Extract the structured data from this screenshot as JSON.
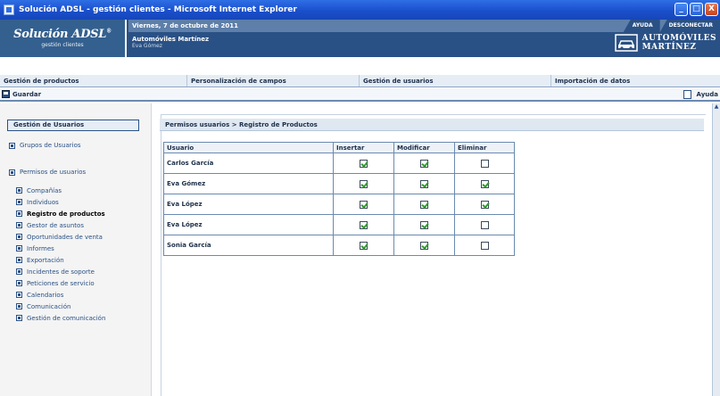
{
  "window": {
    "title": "Solución ADSL - gestión clientes - Microsoft Internet Explorer",
    "buttons": [
      "_",
      "□",
      "X"
    ]
  },
  "header": {
    "logo_title": "Solución ADSL",
    "logo_tm": "®",
    "logo_subtitle": "gestión clientes",
    "date": "Viernes, 7 de octubre de 2011",
    "links": [
      "AYUDA",
      "DESCONECTAR"
    ],
    "company": "Automóviles Martínez",
    "user": "Eva Gómez",
    "brand_line1": "AUTOMÓVILES",
    "brand_line2": "MARTÍNEZ",
    "brand_icon": "car-icon"
  },
  "nav": {
    "items": [
      "Gestión de productos",
      "Personalización de campos",
      "Gestión de usuarios",
      "Importación de datos"
    ]
  },
  "toolbar": {
    "save_label": "Guardar",
    "save_icon": "save-icon",
    "help_label": "Ayuda",
    "help_icon": "help-icon"
  },
  "sidebar": {
    "title": "Gestión de Usuarios",
    "groups_label": "Grupos de Usuarios",
    "permissions_label": "Permisos de usuarios",
    "items": [
      {
        "label": "Compañías",
        "active": false
      },
      {
        "label": "Individuos",
        "active": false
      },
      {
        "label": "Registro de productos",
        "active": true
      },
      {
        "label": "Gestor de asuntos",
        "active": false
      },
      {
        "label": "Oportunidades de venta",
        "active": false
      },
      {
        "label": "Informes",
        "active": false
      },
      {
        "label": "Exportación",
        "active": false
      },
      {
        "label": "Incidentes de soporte",
        "active": false
      },
      {
        "label": "Peticiones de servicio",
        "active": false
      },
      {
        "label": "Calendarios",
        "active": false
      },
      {
        "label": "Comunicación",
        "active": false
      },
      {
        "label": "Gestión de comunicación",
        "active": false
      }
    ]
  },
  "main": {
    "breadcrumb": "Permisos usuarios > Registro de Productos",
    "columns": [
      "Usuario",
      "Insertar",
      "Modificar",
      "Eliminar"
    ],
    "rows": [
      {
        "user": "Carlos García",
        "insertar": true,
        "modificar": true,
        "eliminar": false
      },
      {
        "user": "Eva Gómez",
        "insertar": true,
        "modificar": true,
        "eliminar": true
      },
      {
        "user": "Eva López",
        "insertar": true,
        "modificar": true,
        "eliminar": true
      },
      {
        "user": "Eva López",
        "insertar": true,
        "modificar": true,
        "eliminar": false
      },
      {
        "user": "Sonia García",
        "insertar": true,
        "modificar": true,
        "eliminar": false
      }
    ]
  },
  "colors": {
    "titlebar": "#1a4fcc",
    "header": "#2a5185",
    "date_strip": "#5d7fa9",
    "check": "#2e9a2e"
  }
}
